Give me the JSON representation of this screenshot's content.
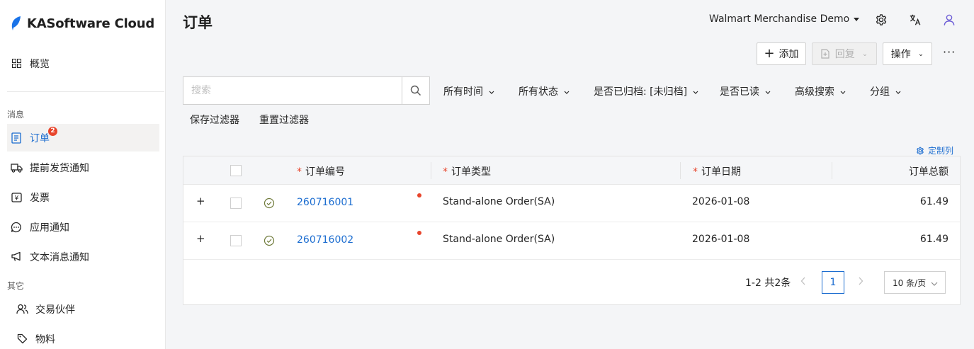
{
  "sidebar": {
    "brand": "KASoftware Cloud",
    "overview": "概览",
    "section_messages": "消息",
    "section_other": "其它",
    "items": {
      "orders": "订单",
      "orders_badge": "2",
      "asn": "提前发货通知",
      "invoice": "发票",
      "app_notice": "应用通知",
      "text_notice": "文本消息通知",
      "partners": "交易伙伴",
      "materials": "物料"
    }
  },
  "header": {
    "title": "订单",
    "org": "Walmart Merchandise Demo"
  },
  "toolbar": {
    "add": "添加",
    "reply": "回复",
    "actions": "操作",
    "more": "···"
  },
  "search": {
    "placeholder": "搜索",
    "value": ""
  },
  "filters": {
    "time": "所有时间",
    "status": "所有状态",
    "archived": "是否已归档: [未归档]",
    "read": "是否已读",
    "advanced": "高级搜索",
    "group": "分组",
    "save": "保存过滤器",
    "reset": "重置过滤器"
  },
  "table": {
    "customize": "定制列",
    "columns": {
      "order_no": "订单编号",
      "order_type": "订单类型",
      "order_date": "订单日期",
      "order_total": "订单总额"
    },
    "rows": [
      {
        "order_no": "260716001",
        "order_type": "Stand-alone Order(SA)",
        "order_date": "2026-01-08",
        "total": "61.49"
      },
      {
        "order_no": "260716002",
        "order_type": "Stand-alone Order(SA)",
        "order_date": "2026-01-08",
        "total": "61.49"
      }
    ]
  },
  "pagination": {
    "total": "1-2 共2条",
    "current": "1",
    "page_size": "10 条/页"
  },
  "colors": {
    "accent": "#1c6dd0",
    "badge": "#e8452c",
    "brand_leaf": "#1a73e8",
    "user_icon": "#6b5bd6",
    "status_ok": "#6f7a3a"
  }
}
